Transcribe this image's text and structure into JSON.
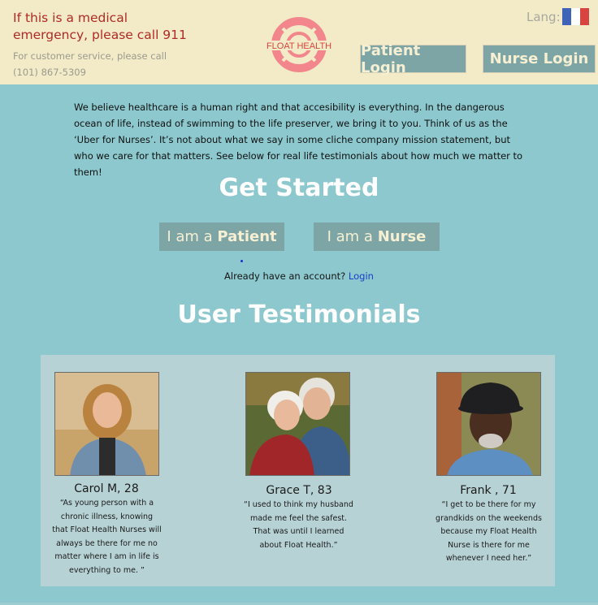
{
  "header": {
    "emergency_text": "If this is a medical emergency, please call 911",
    "service_text": "For customer service, please call (101) 867-5309",
    "logo_text": "FLOAT HEALTH",
    "lang_label": "Lang:",
    "patient_login_label": "Patient Login",
    "nurse_login_label": "Nurse Login",
    "flag_colors": [
      "#3f64b7",
      "#ffffff",
      "#d8443f"
    ]
  },
  "mission": {
    "text": "We believe healthcare is a human right and that accesibility is everything.  In the dangerous ocean of life, instead of swimming to the life preserver, we bring it to you.  Think of us as the ‘Uber for Nurses’.  It’s not about what we say in some cliche company mission statement, but who we care for that matters.  See below for real life testimonials about how much we matter to them!"
  },
  "get_started": {
    "title": "Get Started",
    "patient_prefix": "I am a ",
    "patient_bold": "Patient",
    "nurse_prefix": "I am a ",
    "nurse_bold": "Nurse",
    "already_text": "Already have an account? ",
    "login_link": "Login"
  },
  "testimonials": {
    "title": "User Testimonials",
    "items": [
      {
        "name": "Carol M, 28",
        "quote": "“As young person with a chronic illness, knowing that Float Health Nurses will always be there for me no matter where I am in life is everything to me. ”"
      },
      {
        "name": "Grace T, 83",
        "quote": "“I used to think my husband made me feel the safest. That was until I learned about Float Health.”"
      },
      {
        "name": "Frank , 71",
        "quote": "“I get to be there for my grandkids on the weekends because my Float Health Nurse is there for me whenever I need her.”"
      }
    ]
  },
  "colors": {
    "page_bg": "#8cc8cd",
    "header_bg": "#f3ebc8",
    "button_bg": "#7da5a6",
    "button_text": "#f6efd2",
    "emergency_red": "#b02a25",
    "logo_pink": "#f2868c",
    "link_blue": "#1a3fc8"
  }
}
